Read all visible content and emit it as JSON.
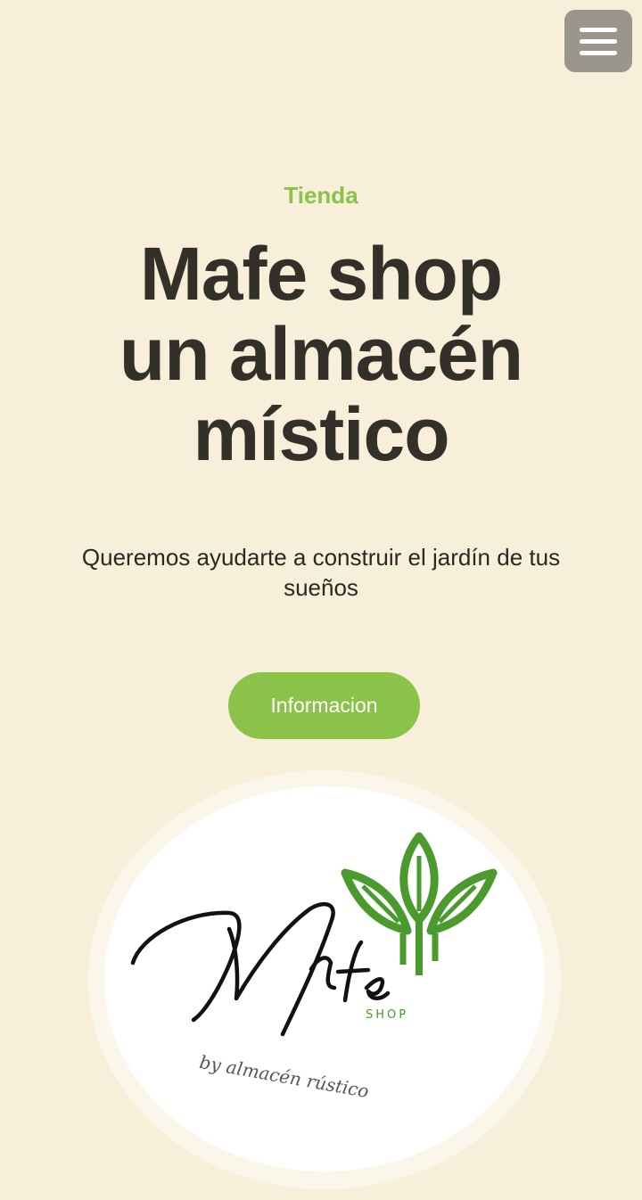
{
  "header": {
    "menu_icon": "hamburger-menu-icon"
  },
  "hero": {
    "eyebrow": "Tienda",
    "title_lines": [
      "Mafe shop",
      "un almacén",
      "místico"
    ],
    "subtitle": "Queremos ayudarte a construir el jardín de tus sueños",
    "cta_label": "Informacion"
  },
  "logo": {
    "script_text": "Mafe",
    "shop_text": "SHOP",
    "tagline": "by almacén rústico",
    "leaf_icon": "leaf-sprout-icon",
    "brand_color": "#4a9a2e"
  },
  "colors": {
    "background": "#f7efda",
    "accent": "#8bc34a",
    "title": "#33302a",
    "menu_button": "#9a968c"
  }
}
